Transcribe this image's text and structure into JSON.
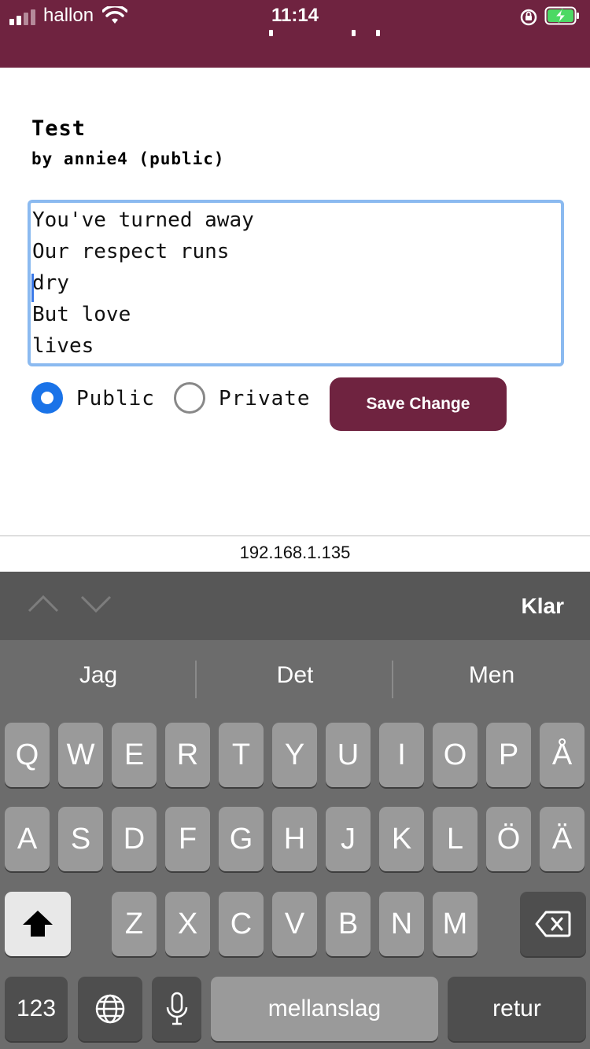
{
  "status": {
    "carrier": "hallon",
    "time": "11:14",
    "colors": {
      "bar": "#6f2340",
      "battery_fill": "#4cd964"
    }
  },
  "post": {
    "title": "Test",
    "byline": "by annie4 (public)",
    "poem": "You've turned away\nOur respect runs\ndry\nBut love\nlives",
    "visibility": {
      "options": [
        "Public",
        "Private"
      ],
      "selected": "Public"
    },
    "save_label": "Save Change",
    "colors": {
      "accent": "#6f2340",
      "radio": "#1a73e8",
      "focus_border": "#8bbaf0"
    }
  },
  "browser": {
    "url": "192.168.1.135"
  },
  "keyboard": {
    "accessory": {
      "done_label": "Klar",
      "prev_icon": "chevron-up-icon",
      "next_icon": "chevron-down-icon"
    },
    "suggestions": [
      "Jag",
      "Det",
      "Men"
    ],
    "rows": [
      [
        "Q",
        "W",
        "E",
        "R",
        "T",
        "Y",
        "U",
        "I",
        "O",
        "P",
        "Å"
      ],
      [
        "A",
        "S",
        "D",
        "F",
        "G",
        "H",
        "J",
        "K",
        "L",
        "Ö",
        "Ä"
      ],
      [
        "Z",
        "X",
        "C",
        "V",
        "B",
        "N",
        "M"
      ]
    ],
    "shift_icon": "shift-icon",
    "backspace_icon": "backspace-icon",
    "numbers_label": "123",
    "globe_icon": "globe-icon",
    "mic_icon": "microphone-icon",
    "space_label": "mellanslag",
    "return_label": "retur"
  }
}
